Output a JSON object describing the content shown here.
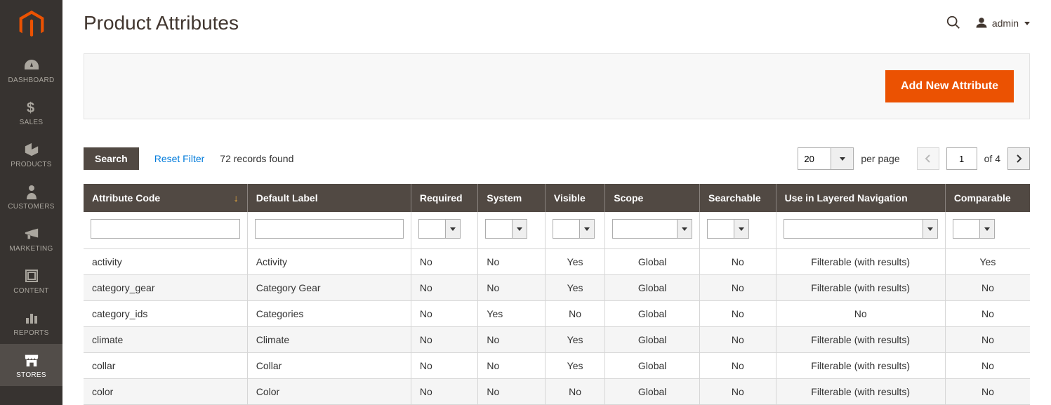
{
  "brand_accent": "#eb5202",
  "sidebar": {
    "items": [
      {
        "key": "dashboard",
        "label": "DASHBOARD"
      },
      {
        "key": "sales",
        "label": "SALES"
      },
      {
        "key": "products",
        "label": "PRODUCTS"
      },
      {
        "key": "customers",
        "label": "CUSTOMERS"
      },
      {
        "key": "marketing",
        "label": "MARKETING"
      },
      {
        "key": "content",
        "label": "CONTENT"
      },
      {
        "key": "reports",
        "label": "REPORTS"
      },
      {
        "key": "stores",
        "label": "STORES"
      }
    ],
    "active": "stores"
  },
  "header": {
    "title": "Product Attributes",
    "user_label": "admin"
  },
  "actions": {
    "add_button": "Add New Attribute"
  },
  "toolbar": {
    "search_label": "Search",
    "reset_label": "Reset Filter",
    "records_found": "72 records found",
    "per_page_value": "20",
    "per_page_label": "per page",
    "page_current": "1",
    "pages_total_label": "of 4"
  },
  "grid": {
    "columns": [
      {
        "key": "code",
        "label": "Attribute Code",
        "sort": "asc",
        "filter": "text",
        "align": "left"
      },
      {
        "key": "label",
        "label": "Default Label",
        "filter": "text",
        "align": "left"
      },
      {
        "key": "required",
        "label": "Required",
        "filter": "select",
        "align": "left"
      },
      {
        "key": "system",
        "label": "System",
        "filter": "select",
        "align": "left"
      },
      {
        "key": "visible",
        "label": "Visible",
        "filter": "select",
        "align": "center"
      },
      {
        "key": "scope",
        "label": "Scope",
        "filter": "select-wide",
        "align": "center"
      },
      {
        "key": "searchable",
        "label": "Searchable",
        "filter": "select",
        "align": "center"
      },
      {
        "key": "layered",
        "label": "Use in Layered Navigation",
        "filter": "select-wide",
        "align": "center"
      },
      {
        "key": "comparable",
        "label": "Comparable",
        "filter": "select",
        "align": "center"
      }
    ],
    "rows": [
      {
        "code": "activity",
        "label": "Activity",
        "required": "No",
        "system": "No",
        "visible": "Yes",
        "scope": "Global",
        "searchable": "No",
        "layered": "Filterable (with results)",
        "comparable": "Yes"
      },
      {
        "code": "category_gear",
        "label": "Category Gear",
        "required": "No",
        "system": "No",
        "visible": "Yes",
        "scope": "Global",
        "searchable": "No",
        "layered": "Filterable (with results)",
        "comparable": "No"
      },
      {
        "code": "category_ids",
        "label": "Categories",
        "required": "No",
        "system": "Yes",
        "visible": "No",
        "scope": "Global",
        "searchable": "No",
        "layered": "No",
        "comparable": "No"
      },
      {
        "code": "climate",
        "label": "Climate",
        "required": "No",
        "system": "No",
        "visible": "Yes",
        "scope": "Global",
        "searchable": "No",
        "layered": "Filterable (with results)",
        "comparable": "No"
      },
      {
        "code": "collar",
        "label": "Collar",
        "required": "No",
        "system": "No",
        "visible": "Yes",
        "scope": "Global",
        "searchable": "No",
        "layered": "Filterable (with results)",
        "comparable": "No"
      },
      {
        "code": "color",
        "label": "Color",
        "required": "No",
        "system": "No",
        "visible": "No",
        "scope": "Global",
        "searchable": "No",
        "layered": "Filterable (with results)",
        "comparable": "No"
      }
    ]
  }
}
